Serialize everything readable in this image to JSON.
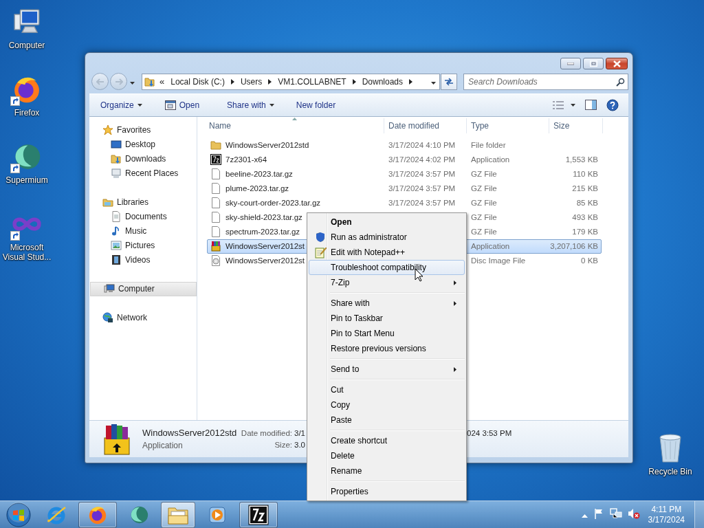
{
  "desktop": {
    "icons": [
      {
        "label": "Computer",
        "kind": "computer",
        "shortcut": false
      },
      {
        "label": "Firefox",
        "kind": "firefox",
        "shortcut": true
      },
      {
        "label": "Supermium",
        "kind": "supermium",
        "shortcut": true
      },
      {
        "label": "Microsoft Visual Stud...",
        "kind": "studio",
        "shortcut": true
      }
    ],
    "recycle_bin": {
      "label": "Recycle Bin"
    }
  },
  "explorer": {
    "nav": {
      "back_disabled": true,
      "forward_disabled": true
    },
    "address": {
      "overflow": "«",
      "crumbs": [
        "Local Disk (C:)",
        "Users",
        "VM1.COLLABNET",
        "Downloads"
      ]
    },
    "search": {
      "placeholder": "Search Downloads"
    },
    "toolbar": [
      {
        "label": "Organize",
        "dropdown": true,
        "has_icon": false
      },
      {
        "label": "Open",
        "dropdown": false,
        "has_icon": true
      },
      {
        "label": "Share with",
        "dropdown": true,
        "has_icon": false
      },
      {
        "label": "New folder",
        "dropdown": false,
        "has_icon": false
      }
    ],
    "sidebar": [
      {
        "label": "Favorites",
        "kind": "favorites",
        "selected": false,
        "children": [
          {
            "label": "Desktop",
            "kind": "desktop",
            "selected": false
          },
          {
            "label": "Downloads",
            "kind": "downloads",
            "selected": false
          },
          {
            "label": "Recent Places",
            "kind": "recent",
            "selected": false
          }
        ]
      },
      {
        "label": "Libraries",
        "kind": "libraries",
        "selected": false,
        "children": [
          {
            "label": "Documents",
            "kind": "documents",
            "selected": false
          },
          {
            "label": "Music",
            "kind": "music",
            "selected": false
          },
          {
            "label": "Pictures",
            "kind": "pictures",
            "selected": false
          },
          {
            "label": "Videos",
            "kind": "videos",
            "selected": false
          }
        ]
      },
      {
        "label": "Computer",
        "kind": "computer",
        "selected": true
      },
      {
        "label": "Network",
        "kind": "network",
        "selected": false
      }
    ],
    "columns": [
      {
        "label": "Name",
        "sorted": true
      },
      {
        "label": "Date modified",
        "sorted": false
      },
      {
        "label": "Type",
        "sorted": false
      },
      {
        "label": "Size",
        "sorted": false
      }
    ],
    "rows": [
      {
        "name": "WindowsServer2012std",
        "date": "3/17/2024 4:10 PM",
        "type": "File folder",
        "kind": "folder",
        "selected": false
      },
      {
        "name": "7z2301-x64",
        "date": "3/17/2024 4:02 PM",
        "type": "Application",
        "size": "1,553 KB",
        "kind": "sevenzip",
        "selected": false
      },
      {
        "name": "beeline-2023.tar.gz",
        "date": "3/17/2024 3:57 PM",
        "type": "GZ File",
        "size": "110 KB",
        "kind": "file",
        "selected": false
      },
      {
        "name": "plume-2023.tar.gz",
        "date": "3/17/2024 3:57 PM",
        "type": "GZ File",
        "size": "215 KB",
        "kind": "file",
        "selected": false
      },
      {
        "name": "sky-court-order-2023.tar.gz",
        "date": "3/17/2024 3:57 PM",
        "type": "GZ File",
        "size": "85 KB",
        "kind": "file",
        "selected": false
      },
      {
        "name": "sky-shield-2023.tar.gz",
        "type": "GZ File",
        "size": "493 KB",
        "kind": "file",
        "selected": false
      },
      {
        "name": "spectrum-2023.tar.gz",
        "type": "GZ File",
        "size": "179 KB",
        "kind": "file",
        "selected": false
      },
      {
        "name": "WindowsServer2012st",
        "type": "Application",
        "size": "3,207,106 KB",
        "kind": "archive",
        "selected": true
      },
      {
        "name": "WindowsServer2012st",
        "type": "Disc Image File",
        "size": "0 KB",
        "kind": "disc",
        "selected": false
      }
    ],
    "details": {
      "name": "WindowsServer2012std",
      "type": "Application",
      "fields": [
        {
          "label": "Date modified:",
          "value": "3/1",
          "value_tail": "024 3:53 PM"
        },
        {
          "label": "Size:",
          "value": "3.0"
        }
      ]
    }
  },
  "context_menu": {
    "items": [
      {
        "kind": "item",
        "label": "Open",
        "default": true,
        "selected": false,
        "submenu": false
      },
      {
        "kind": "shield",
        "label": "Run as administrator",
        "default": false,
        "selected": false,
        "submenu": false
      },
      {
        "kind": "notepad",
        "label": "Edit with Notepad++",
        "default": false,
        "selected": false,
        "submenu": false
      },
      {
        "kind": "item",
        "label": "Troubleshoot compatibility",
        "default": false,
        "selected": true,
        "submenu": false
      },
      {
        "kind": "item",
        "label": "7-Zip",
        "default": false,
        "selected": false,
        "submenu": true
      },
      {
        "kind": "separator"
      },
      {
        "kind": "item",
        "label": "Share with",
        "default": false,
        "selected": false,
        "submenu": true
      },
      {
        "kind": "item",
        "label": "Pin to Taskbar",
        "default": false,
        "selected": false,
        "submenu": false
      },
      {
        "kind": "item",
        "label": "Pin to Start Menu",
        "default": false,
        "selected": false,
        "submenu": false
      },
      {
        "kind": "item",
        "label": "Restore previous versions",
        "default": false,
        "selected": false,
        "submenu": false
      },
      {
        "kind": "separator"
      },
      {
        "kind": "item",
        "label": "Send to",
        "default": false,
        "selected": false,
        "submenu": true
      },
      {
        "kind": "separator"
      },
      {
        "kind": "item",
        "label": "Cut",
        "default": false,
        "selected": false,
        "submenu": false
      },
      {
        "kind": "item",
        "label": "Copy",
        "default": false,
        "selected": false,
        "submenu": false
      },
      {
        "kind": "item",
        "label": "Paste",
        "default": false,
        "selected": false,
        "submenu": false
      },
      {
        "kind": "separator"
      },
      {
        "kind": "item",
        "label": "Create shortcut",
        "default": false,
        "selected": false,
        "submenu": false
      },
      {
        "kind": "item",
        "label": "Delete",
        "default": false,
        "selected": false,
        "submenu": false
      },
      {
        "kind": "item",
        "label": "Rename",
        "default": false,
        "selected": false,
        "submenu": false
      },
      {
        "kind": "separator"
      },
      {
        "kind": "item",
        "label": "Properties",
        "default": false,
        "selected": false,
        "submenu": false
      }
    ]
  },
  "taskbar": {
    "apps": [
      {
        "kind": "browser-e",
        "running": false,
        "active": false
      },
      {
        "kind": "firefox",
        "running": true,
        "active": false
      },
      {
        "kind": "supermium",
        "running": false,
        "active": false
      },
      {
        "kind": "explorer",
        "running": true,
        "active": true
      },
      {
        "kind": "media",
        "running": false,
        "active": false
      },
      {
        "kind": "sevenzip",
        "running": true,
        "active": false
      }
    ],
    "clock": {
      "time": "4:11 PM",
      "date": "3/17/2024"
    }
  }
}
